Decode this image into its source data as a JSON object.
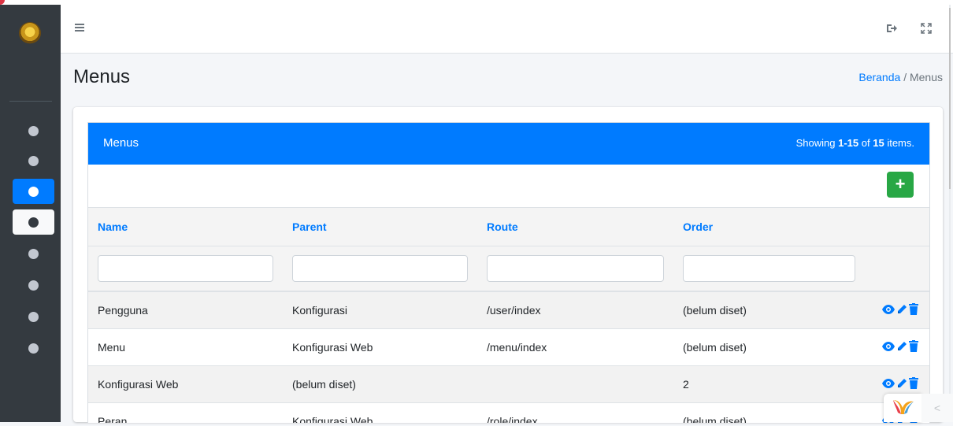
{
  "sidebar": {
    "items": [
      {
        "state": "normal"
      },
      {
        "state": "normal"
      },
      {
        "state": "active-blue"
      },
      {
        "state": "active-white"
      },
      {
        "state": "normal"
      },
      {
        "state": "normal"
      },
      {
        "state": "normal"
      },
      {
        "state": "normal"
      }
    ]
  },
  "header": {
    "title": "Menus",
    "breadcrumb": {
      "home": "Beranda",
      "separator": "/",
      "current": "Menus"
    }
  },
  "panel": {
    "title": "Menus",
    "summary": {
      "prefix": "Showing ",
      "range": "1-15",
      "mid": " of ",
      "total": "15",
      "suffix": " items."
    },
    "add_label": "+"
  },
  "table": {
    "columns": [
      "Name",
      "Parent",
      "Route",
      "Order"
    ],
    "rows": [
      {
        "name": "Pengguna",
        "parent": "Konfigurasi",
        "route": "/user/index",
        "order": "(belum diset)"
      },
      {
        "name": "Menu",
        "parent": "Konfigurasi Web",
        "route": "/menu/index",
        "order": "(belum diset)"
      },
      {
        "name": "Konfigurasi Web",
        "parent": "(belum diset)",
        "route": "",
        "order": "2"
      },
      {
        "name": "Peran",
        "parent": "Konfigurasi Web",
        "route": "/role/index",
        "order": "(belum diset)"
      }
    ]
  },
  "colors": {
    "primary": "#007bff",
    "success": "#28a745",
    "sidebar": "#343a40"
  },
  "icons": {
    "hamburger": "bars-icon",
    "logout": "sign-out-icon",
    "fullscreen": "expand-icon",
    "view": "eye-icon",
    "edit": "pencil-icon",
    "delete": "trash-icon"
  }
}
